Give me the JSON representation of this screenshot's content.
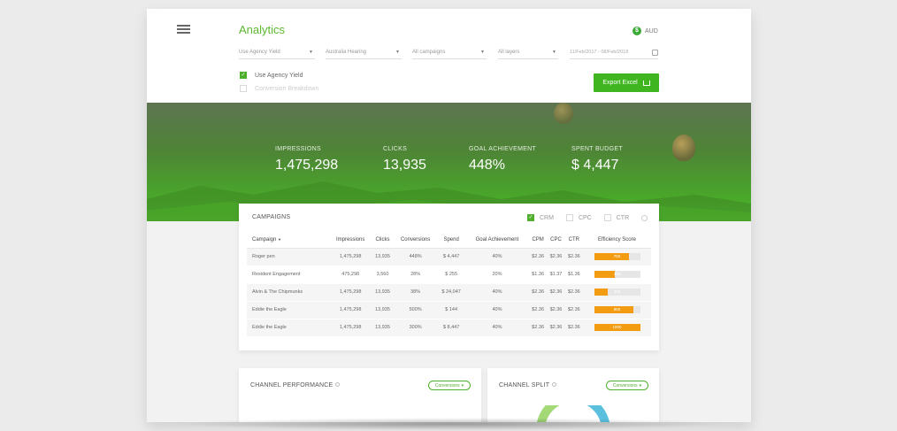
{
  "header": {
    "title": "Analytics",
    "currency": "AUD",
    "currency_symbol": "$",
    "filters": [
      "Use Agency Yield",
      "Australia Hearing",
      "All campaigns",
      "All layers"
    ],
    "date_range": "11/Feb/2017 - 08/Feb/2018",
    "options": [
      {
        "label": "Use Agency Yield",
        "checked": true
      },
      {
        "label": "Conversion Breakdown",
        "checked": false
      }
    ],
    "export_label": "Export Excel"
  },
  "stats": [
    {
      "label": "IMPRESSIONS",
      "value": "1,475,298"
    },
    {
      "label": "CLICKS",
      "value": "13,935"
    },
    {
      "label": "GOAL ACHIEVEMENT",
      "value": "448%"
    },
    {
      "label": "SPENT BUDGET",
      "value": "$ 4,447"
    }
  ],
  "campaigns": {
    "title": "CAMPAIGNS",
    "toggles": [
      "CRM",
      "CPC",
      "CTR"
    ],
    "columns": [
      "Campaign",
      "Impressions",
      "Clicks",
      "Conversions",
      "Spend",
      "Goal Achievement",
      "CPM",
      "CPC",
      "CTR",
      "Efficiency Score"
    ],
    "rows": [
      {
        "cells": [
          "Roger pen",
          "1,475,298",
          "13,935",
          "448%",
          "$ 4,447",
          "40%",
          "$2.36",
          "$2.36",
          "$2.36"
        ],
        "score": "750",
        "fill": 0.75
      },
      {
        "cells": [
          "Resident Engagement",
          "475,298",
          "3,560",
          "28%",
          "$ 255",
          "20%",
          "$1.36",
          "$1.37",
          "$1.36"
        ],
        "score": "450",
        "fill": 0.45
      },
      {
        "cells": [
          "Alvin & The Chipmunks",
          "1,475,298",
          "13,935",
          "38%",
          "$ 24,047",
          "40%",
          "$2.36",
          "$2.36",
          "$2.36"
        ],
        "score": "300",
        "fill": 0.3
      },
      {
        "cells": [
          "Eddie the Eagle",
          "1,475,298",
          "13,935",
          "500%",
          "$ 144",
          "40%",
          "$2.36",
          "$2.36",
          "$2.36"
        ],
        "score": "850",
        "fill": 0.85
      },
      {
        "cells": [
          "Eddie the Eagle",
          "1,475,298",
          "13,935",
          "300%",
          "$ 8,447",
          "40%",
          "$2.36",
          "$2.36",
          "$2.36"
        ],
        "score": "1000",
        "fill": 1.0
      }
    ]
  },
  "channel_performance": {
    "title": "CHANNEL PERFORMANCE",
    "dropdown": "Conversions"
  },
  "channel_split": {
    "title": "CHANNEL SPLIT",
    "dropdown": "Conversions"
  }
}
